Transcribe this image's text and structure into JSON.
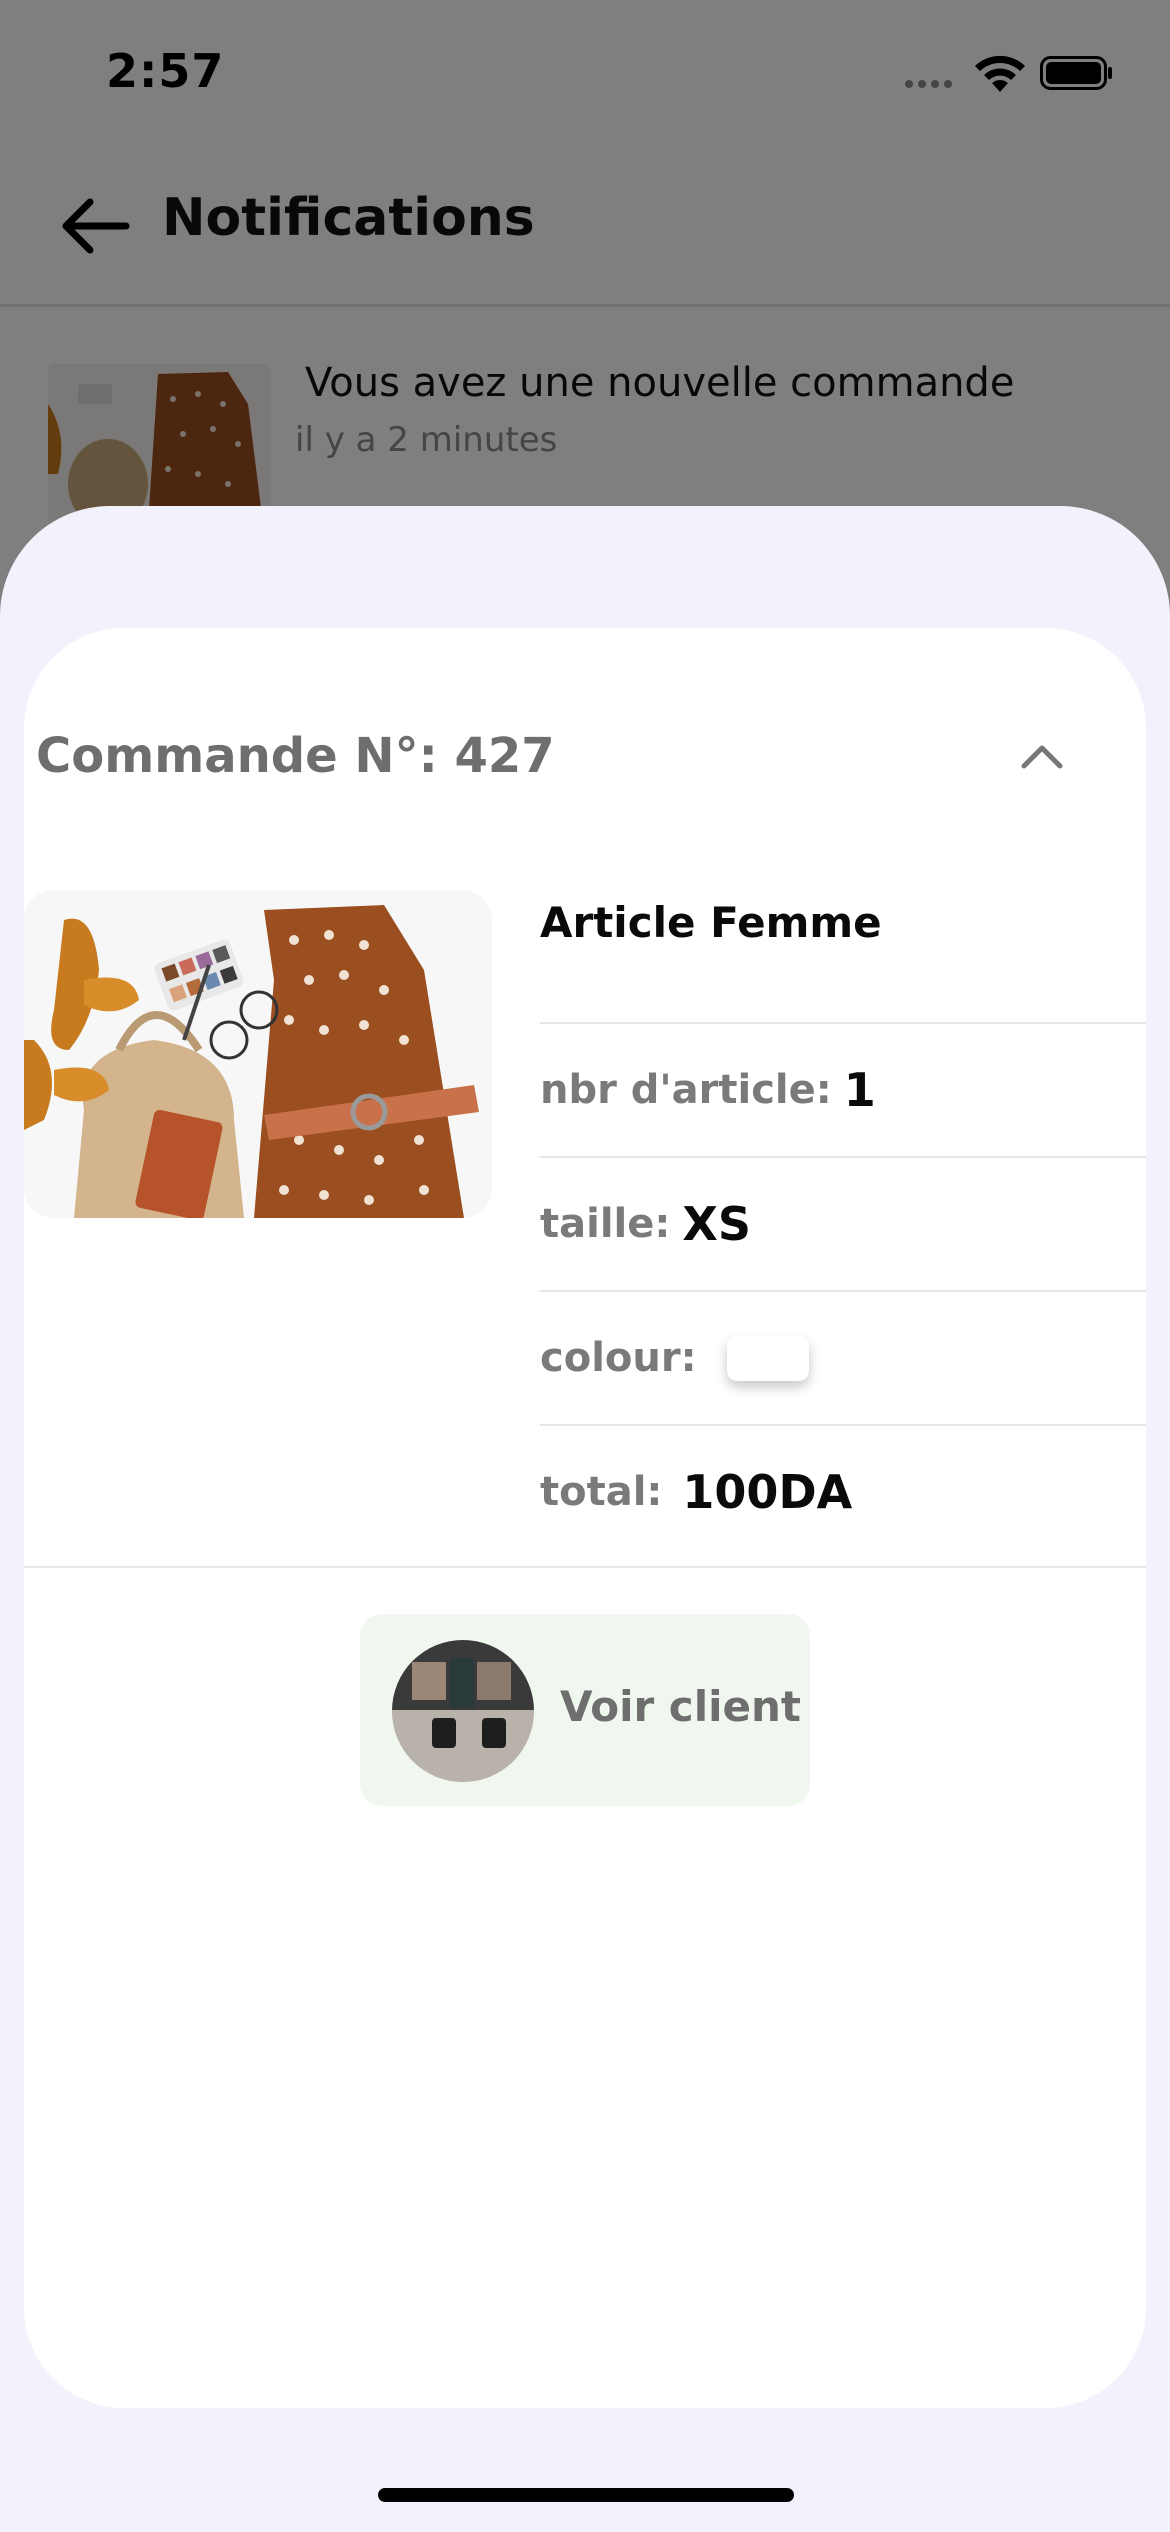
{
  "status_bar": {
    "time": "2:57"
  },
  "header": {
    "title": "Notifications"
  },
  "notification": {
    "title": "Vous avez une nouvelle commande",
    "time": "il y a 2 minutes"
  },
  "order": {
    "title": "Commande N°: 427",
    "product_name": "Article Femme",
    "quantity_label": "nbr d'article:",
    "quantity_value": "1",
    "size_label": "taille:",
    "size_value": "XS",
    "colour_label": "colour:",
    "colour_value": "#ffffff",
    "total_label": "total:",
    "total_value": "100DA"
  },
  "client_button": {
    "label": "Voir client"
  },
  "colors": {
    "sheet_background": "#f2f2fd",
    "card_background": "#ffffff",
    "client_button_background": "#eff7ee",
    "label_gray": "#7a7a7a"
  }
}
